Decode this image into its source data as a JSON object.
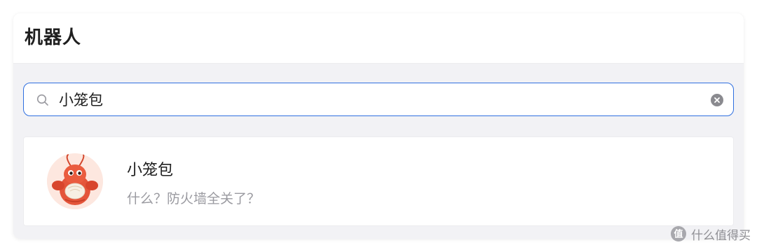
{
  "header": {
    "title": "机器人"
  },
  "search": {
    "value": "小笼包",
    "icon": "search-icon",
    "clear_icon": "clear-icon"
  },
  "results": [
    {
      "name": "小笼包",
      "description": "什么？防火墙全关了？",
      "avatar_icon": "lobster-avatar"
    }
  ],
  "watermark": {
    "text": "什么值得买"
  },
  "colors": {
    "accent": "#2f6fe0",
    "background": "#f2f2f5",
    "muted_text": "#9a9aa0"
  }
}
